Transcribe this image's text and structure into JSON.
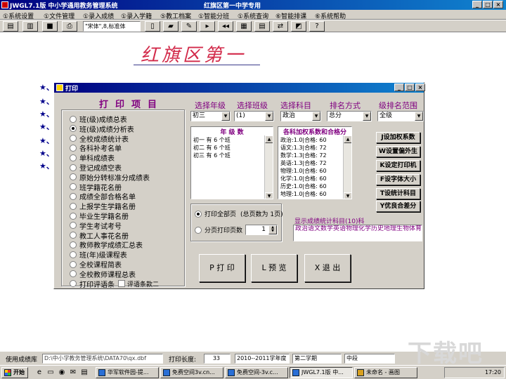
{
  "window": {
    "app_title": "JWGL7.1版 中小学通用教务管理系统",
    "center_title": "红旗区第一中学专用",
    "cap_buttons": [
      "_",
      "□",
      "×"
    ]
  },
  "menu": [
    "①系统设置",
    "①文件管理",
    "①录入成绩",
    "①录入学籍",
    "⑤教工档案",
    "①智能分班",
    "①系统查询",
    "⑥智能排课",
    "⑥系统帮助"
  ],
  "toolbar": {
    "font_value": "\"宋体\",8,标准体",
    "icons": [
      "report-icon",
      "chart-icon",
      "save-icon",
      "print-icon",
      "new-icon",
      "open-icon",
      "pencil-icon",
      "next-icon",
      "rewind-icon",
      "grid-icon",
      "table-icon",
      "export-icon",
      "color-icon",
      "help-icon"
    ]
  },
  "document": {
    "heading": "红旗区第一",
    "star": "★、"
  },
  "dialog": {
    "title": "打印",
    "caption_buttons": [
      "_",
      "□",
      "×"
    ],
    "print_items_heading": "打印项目",
    "report_items": [
      "班(级)成绩总表",
      "班(级)成绩分析表",
      "全校成绩统计表",
      "各科补考名单",
      "单科成绩表",
      "登记成绩空表",
      "原始分转标准分成绩表",
      "班学籍花名册",
      "成绩全部合格名单",
      "上报学生学籍名册",
      "毕业生学籍名册",
      "学生考试考号",
      "教工人事花名册",
      "教师教学成绩汇总表",
      "班(年)级课程表",
      "全校课程简表",
      "全校教师课程总表",
      "打印评语条"
    ],
    "selected_report_index": 1,
    "comment_checkbox_label": "评语条款二",
    "labels": {
      "grade": "选择年级",
      "class": "选择班级",
      "subject": "选择科目",
      "rank_method": "排名方式",
      "rank_range": "级排名范围"
    },
    "selects": {
      "grade": "初三",
      "class": "(1)",
      "subject": "政治",
      "rank_method": "总分",
      "rank_range": "全级"
    },
    "grade_list_header": "年 级 数",
    "grade_list": [
      "初一 有  6 个班",
      "初二 有  6 个班",
      "初三 有  6 个班"
    ],
    "weights_header": "各科加权系数和合格分",
    "weights": [
      "政治:1.0|合格: 60",
      "语文:1.3|合格: 72",
      "数学:1.3|合格: 72",
      "英语:1.3|合格: 72",
      "物理:1.0|合格: 60",
      "化学:1.0|合格: 60",
      "历史:1.0|合格: 60",
      "地理:1.0|合格: 60"
    ],
    "side_buttons": [
      "J设加权系数",
      "W设置偏外生",
      "K设定打印机",
      "F设字体大小",
      "T设统计科目",
      "Y优良合差分"
    ],
    "print_all_label": "打印全部页",
    "total_pages": "(总页数为 1页)",
    "paged_print_label": "分页打印页数",
    "page_count": "1",
    "stats_subjects_label": "显示成绩统计科目(10)科",
    "stats_subjects": "政治语文数学英语物理化学历史地理生物体育",
    "buttons": {
      "print": "P 打 印",
      "preview": "L 预 览",
      "exit": "X 退 出"
    }
  },
  "status": {
    "db_label": "使用成绩库",
    "db_path": "D:\\中小学教务管理系统\\DATA70\\qx.dbf",
    "print_length_label": "打印长度:",
    "print_length": "33",
    "school_year": "2010--2011学年度",
    "term": "第二学期",
    "exam": "中段"
  },
  "taskbar": {
    "start": "开始",
    "tasks": [
      "华军软件园-提...",
      "免费空间3v.cn...",
      "免费空间-3v.c...",
      "JWGL7.1版 中...",
      "未命名 - 画图"
    ],
    "active_task_index": 3,
    "clock": "17:20"
  },
  "watermark": "下载吧"
}
